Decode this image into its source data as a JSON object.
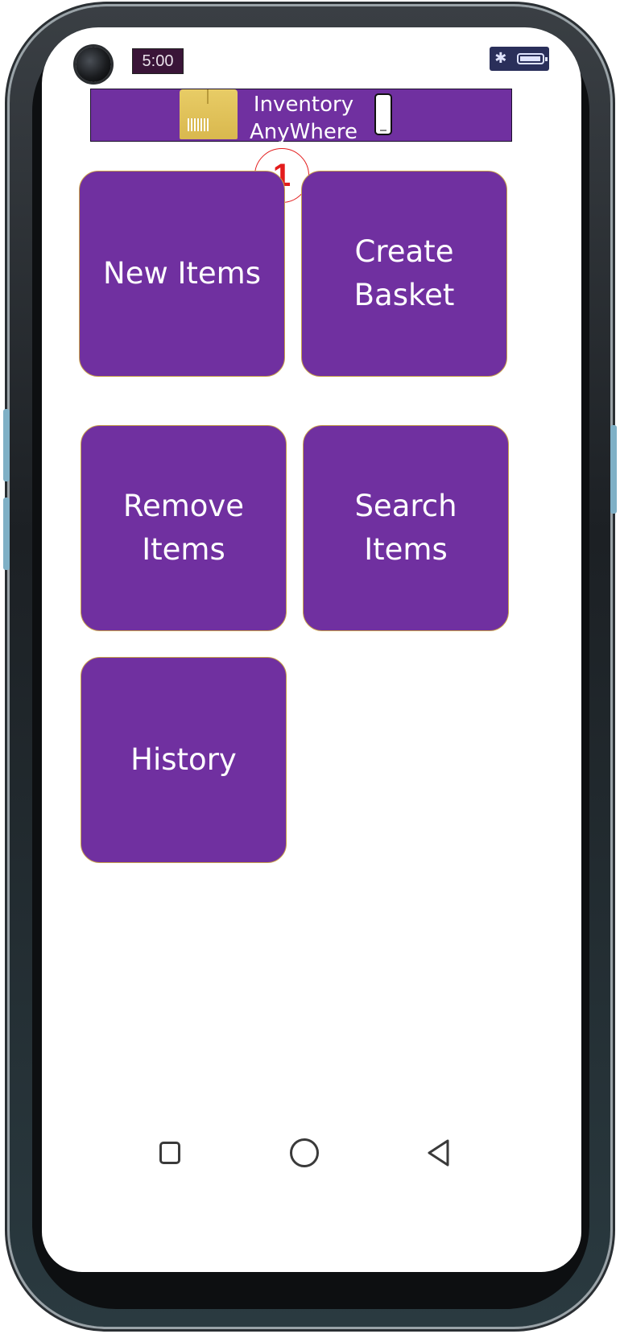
{
  "status_bar": {
    "time": "5:00",
    "bluetooth_icon": "bluetooth-icon",
    "battery_icon": "battery-icon"
  },
  "header": {
    "title_line1": "Inventory",
    "title_line2": "AnyWhere",
    "logo_icon": "package-box-icon",
    "device_icon": "smartphone-icon",
    "background_color": "#7030a0"
  },
  "annotation": {
    "marker_label": "1"
  },
  "tiles": [
    {
      "label": "New Items"
    },
    {
      "label": "Create\nBasket"
    },
    {
      "label": "Remove\nItems"
    },
    {
      "label": "Search\nItems"
    },
    {
      "label": "History"
    }
  ],
  "nav_bar": {
    "recent_icon": "square-icon",
    "home_icon": "circle-icon",
    "back_icon": "triangle-back-icon"
  },
  "colors": {
    "accent": "#7030a0",
    "tile_border": "#c9a24a",
    "marker": "#e31b1b"
  }
}
